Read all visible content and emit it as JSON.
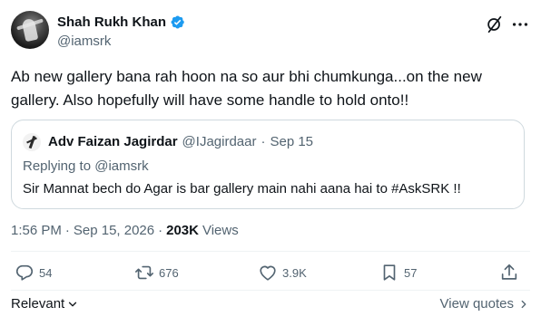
{
  "author": {
    "display_name": "Shah Rukh Khan",
    "handle": "@iamsrk",
    "verified_color": "#1d9bf0"
  },
  "icons": {
    "verified": "verified-badge-icon",
    "grok": "grok-icon",
    "more": "more-options-icon"
  },
  "tweet": {
    "text": "Ab new gallery bana rah hoon na so aur bhi chumkunga...on the new gallery. Also hopefully will have some handle to hold onto!!"
  },
  "quote": {
    "display_name": "Adv Faizan Jagirdar",
    "handle": "@IJagirdaar",
    "separator": "·",
    "date": "Sep 15",
    "replying_to": "Replying to @iamsrk",
    "text": "Sir Mannat bech do Agar is bar gallery main nahi aana hai to #AskSRK !!"
  },
  "timeline": {
    "time": "1:56 PM",
    "separator": "·",
    "date": "Sep 15, 2026",
    "separator2": "·",
    "views_count": "203K",
    "views_label": "Views"
  },
  "actions": {
    "replies": "54",
    "reposts": "676",
    "likes": "3.9K",
    "bookmarks": "57"
  },
  "footer": {
    "relevant_label": "Relevant",
    "view_quotes_label": "View quotes"
  }
}
